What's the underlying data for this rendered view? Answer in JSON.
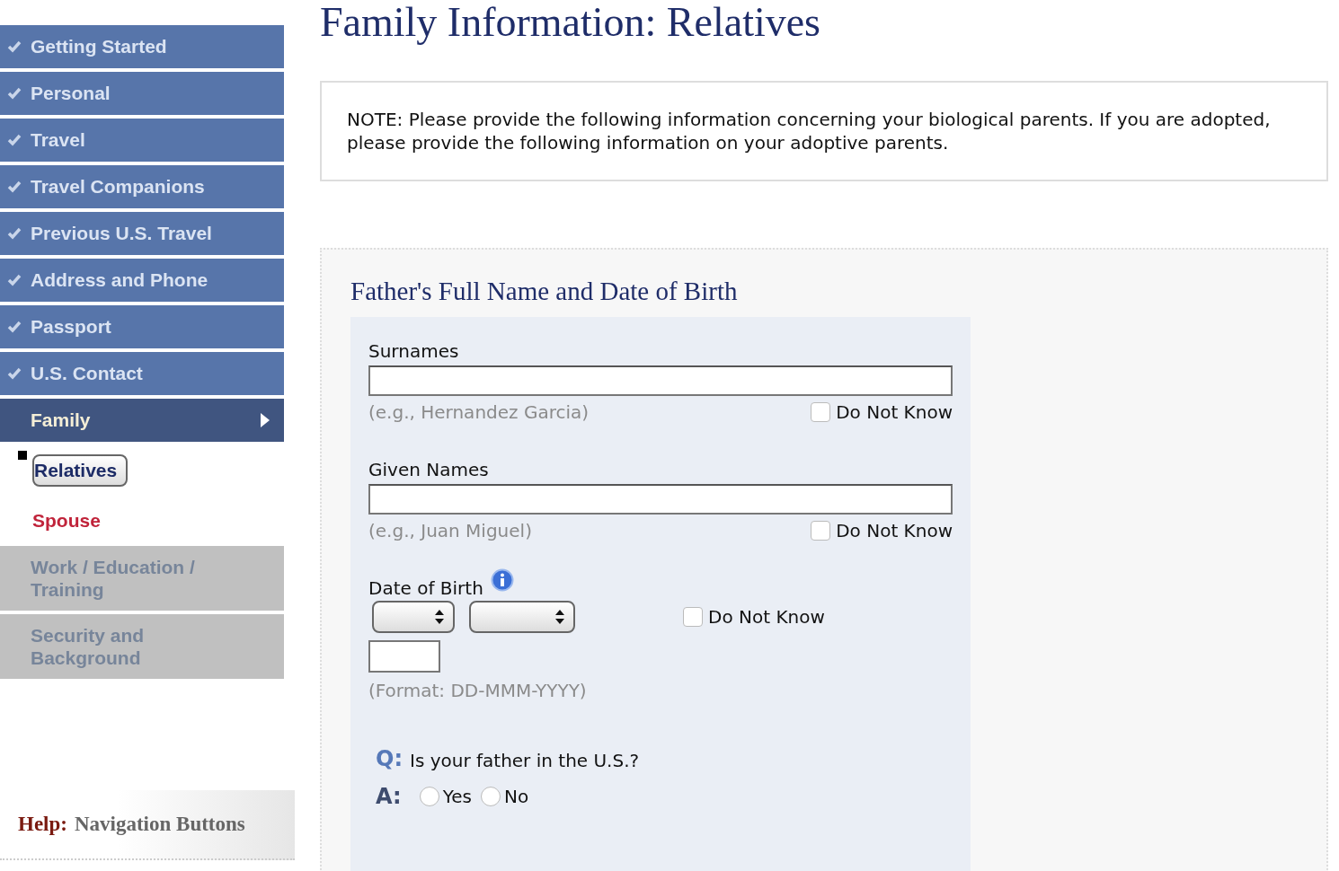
{
  "sidebar": {
    "items": [
      {
        "label": "Getting Started",
        "kind": "completed"
      },
      {
        "label": "Personal",
        "kind": "completed"
      },
      {
        "label": "Travel",
        "kind": "completed"
      },
      {
        "label": "Travel Companions",
        "kind": "completed"
      },
      {
        "label": "Previous U.S. Travel",
        "kind": "completed"
      },
      {
        "label": "Address and Phone",
        "kind": "completed"
      },
      {
        "label": "Passport",
        "kind": "completed"
      },
      {
        "label": "U.S. Contact",
        "kind": "completed"
      },
      {
        "label": "Family",
        "kind": "current",
        "expanded": true,
        "children": [
          {
            "label": "Relatives",
            "selected": true
          },
          {
            "label": "Spouse",
            "selected": false
          }
        ]
      },
      {
        "label": "Work / Education / Training",
        "kind": "locked"
      },
      {
        "label": "Security and Background",
        "kind": "locked"
      }
    ]
  },
  "help": {
    "label": "Help:",
    "topic": "Navigation Buttons"
  },
  "page_title": "Family Information: Relatives",
  "note": "NOTE: Please provide the following information concerning your biological parents. If you are adopted, please provide the following information on your adoptive parents.",
  "section": {
    "title": "Father's Full Name and Date of Birth",
    "fields": [
      {
        "kind": "text",
        "label": "Surnames",
        "hint": "(e.g., Hernandez Garcia)",
        "do_not_know": {
          "label": "Do Not Know",
          "checked": false
        }
      },
      {
        "kind": "text",
        "label": "Given Names",
        "hint": "(e.g., Juan Miguel)",
        "do_not_know": {
          "label": "Do Not Know",
          "checked": false
        }
      },
      {
        "kind": "date",
        "label": "Date of Birth",
        "hint": "(Format: DD-MMM-YYYY)",
        "do_not_know": {
          "label": "Do Not Know",
          "checked": false
        }
      }
    ],
    "question": {
      "q_marker": "Q:",
      "text": "Is your father in the U.S.?",
      "a_marker": "A:",
      "options": [
        {
          "label": "Yes",
          "selected": false
        },
        {
          "label": "No",
          "selected": false
        }
      ]
    }
  }
}
